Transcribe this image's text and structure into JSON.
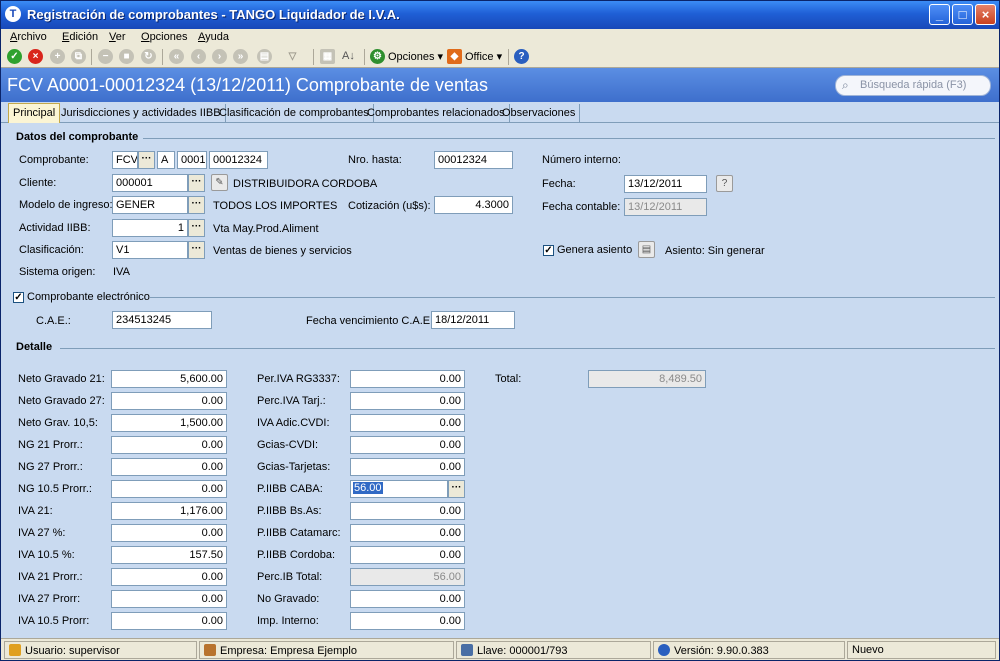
{
  "window": {
    "title": "Registración de comprobantes - TANGO Liquidador de I.V.A."
  },
  "menu": [
    "Archivo",
    "Edición",
    "Ver",
    "Opciones",
    "Ayuda"
  ],
  "toolbar": {
    "opciones_label": "Opciones",
    "office_label": "Office",
    "sort_label": "A↓"
  },
  "header": {
    "title": "FCV A0001-00012324  (13/12/2011)  Comprobante de ventas",
    "search_placeholder": "Búsqueda rápida (F3)"
  },
  "tabs": [
    "Principal",
    "Jurisdicciones y actividades IIBB",
    "Clasificación de comprobantes",
    "Comprobantes relacionados",
    "Observaciones"
  ],
  "datos": {
    "section_title": "Datos del comprobante",
    "comprobante_label": "Comprobante:",
    "comprobante_tipo": "FCV",
    "comprobante_letra": "A",
    "comprobante_pv": "0001",
    "comprobante_numero": "00012324",
    "nro_hasta_label": "Nro. hasta:",
    "nro_hasta_value": "00012324",
    "numero_interno_label": "Número interno:",
    "cliente_label": "Cliente:",
    "cliente_codigo": "000001",
    "cliente_nombre": "DISTRIBUIDORA CORDOBA",
    "fecha_label": "Fecha:",
    "fecha_value": "13/12/2011",
    "modelo_label": "Modelo de ingreso:",
    "modelo_value": "GENER",
    "modelo_desc": "TODOS LOS IMPORTES",
    "cotizacion_label": "Cotización (u$s):",
    "cotizacion_value": "4.3000",
    "fecha_contable_label": "Fecha contable:",
    "fecha_contable_value": "13/12/2011",
    "actividad_label": "Actividad IIBB:",
    "actividad_value": "1",
    "actividad_desc": "Vta May.Prod.Aliment",
    "clasificacion_label": "Clasificación:",
    "clasificacion_value": "V1",
    "clasificacion_desc": "Ventas de bienes y servicios",
    "genera_asiento_label": "Genera asiento",
    "asiento_label": "Asiento: Sin generar",
    "sistema_origen_label": "Sistema origen:",
    "sistema_origen_value": "IVA",
    "comp_electronico_label": "Comprobante electrónico",
    "cae_label": "C.A.E.:",
    "cae_value": "234513245",
    "fecha_venc_cae_label": "Fecha vencimiento C.A.E.:",
    "fecha_venc_cae_value": "18/12/2011"
  },
  "detalle": {
    "section_title": "Detalle",
    "left": [
      {
        "label": "Neto Gravado 21:",
        "value": "5,600.00"
      },
      {
        "label": "Neto Gravado 27:",
        "value": "0.00"
      },
      {
        "label": "Neto Grav. 10,5:",
        "value": "1,500.00"
      },
      {
        "label": "NG 21 Prorr.:",
        "value": "0.00"
      },
      {
        "label": "NG 27 Prorr.:",
        "value": "0.00"
      },
      {
        "label": "NG 10.5 Prorr.:",
        "value": "0.00"
      },
      {
        "label": "IVA 21:",
        "value": "1,176.00"
      },
      {
        "label": "IVA 27 %:",
        "value": "0.00"
      },
      {
        "label": "IVA 10.5 %:",
        "value": "157.50"
      },
      {
        "label": "IVA 21 Prorr.:",
        "value": "0.00"
      },
      {
        "label": "IVA 27 Prorr:",
        "value": "0.00"
      },
      {
        "label": "IVA 10.5 Prorr:",
        "value": "0.00"
      }
    ],
    "middle": [
      {
        "label": "Per.IVA RG3337:",
        "value": "0.00"
      },
      {
        "label": "Perc.IVA Tarj.:",
        "value": "0.00"
      },
      {
        "label": "IVA Adic.CVDI:",
        "value": "0.00"
      },
      {
        "label": "Gcias-CVDI:",
        "value": "0.00"
      },
      {
        "label": "Gcias-Tarjetas:",
        "value": "0.00"
      },
      {
        "label": "P.IIBB CABA:",
        "value": "56.00"
      },
      {
        "label": "P.IIBB Bs.As:",
        "value": "0.00"
      },
      {
        "label": "P.IIBB Catamarc:",
        "value": "0.00"
      },
      {
        "label": "P.IIBB Cordoba:",
        "value": "0.00"
      },
      {
        "label": "Perc.IB Total:",
        "value": "56.00"
      },
      {
        "label": "No Gravado:",
        "value": "0.00"
      },
      {
        "label": "Imp. Interno:",
        "value": "0.00"
      }
    ],
    "total_label": "Total:",
    "total_value": "8,489.50"
  },
  "statusbar": {
    "usuario": "Usuario: supervisor",
    "empresa": "Empresa: Empresa Ejemplo",
    "llave": "Llave: 000001/793",
    "version": "Versión: 9.90.0.383",
    "estado": "Nuevo"
  },
  "colors": {
    "titlebar": "#1f5fd6",
    "header_band": "#4a7fd8",
    "form_bg": "#c9daf0",
    "selection": "#316ac5"
  }
}
